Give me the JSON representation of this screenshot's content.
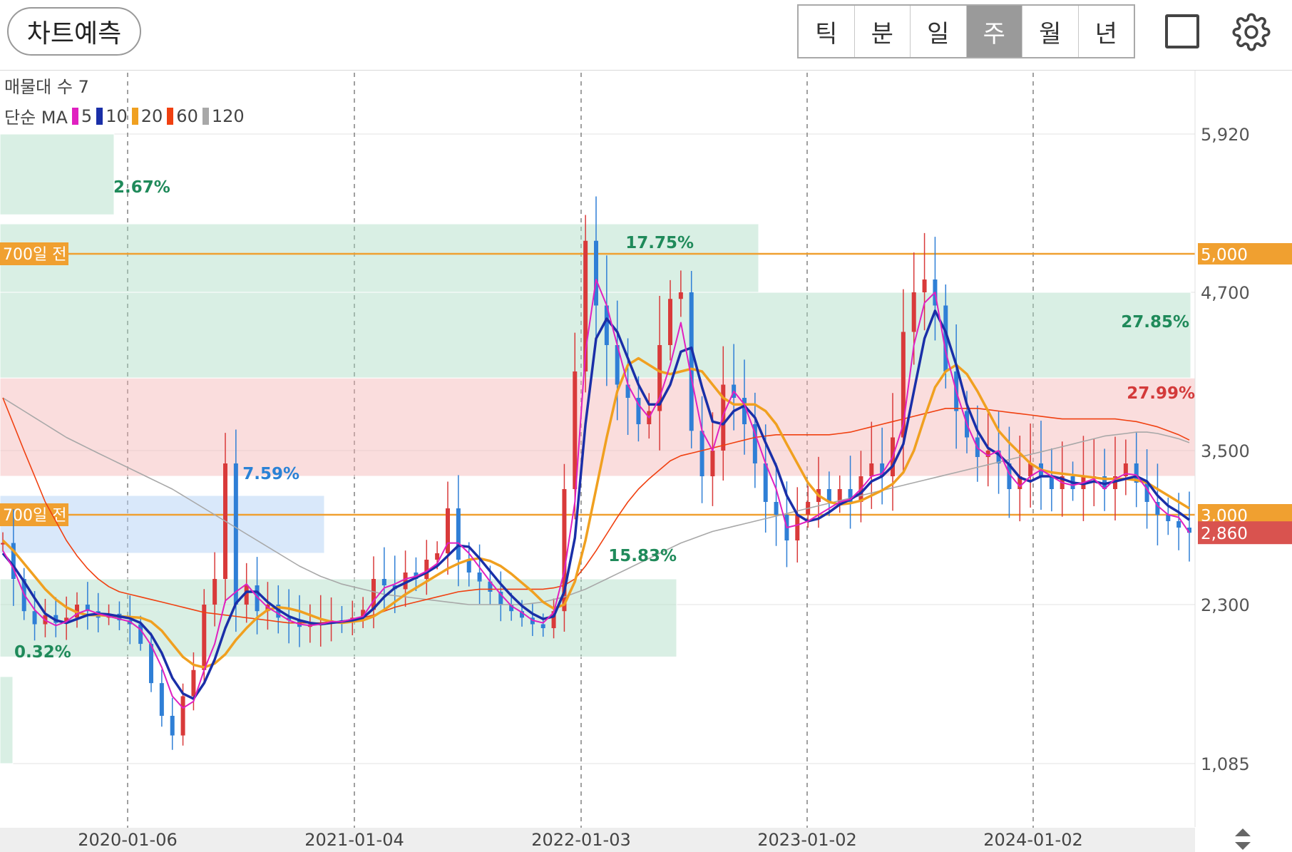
{
  "toolbar": {
    "predict_label": "차트예측",
    "period_tabs": [
      "틱",
      "분",
      "일",
      "주",
      "월",
      "년"
    ],
    "active_tab": "주",
    "icons": [
      "square-icon",
      "gear-icon"
    ]
  },
  "legend": {
    "volume_profile_label": "매물대 수 7",
    "ma_label": "단순 MA",
    "ma_items": [
      {
        "period": "5",
        "color": "#e020c0"
      },
      {
        "period": "10",
        "color": "#1a2fa8"
      },
      {
        "period": "20",
        "color": "#f0a020"
      },
      {
        "period": "60",
        "color": "#f04010"
      },
      {
        "period": "120",
        "color": "#a8a8a8"
      }
    ]
  },
  "chart_data": {
    "type": "candlestick",
    "interval": "weekly",
    "y_axis_ticks": [
      1085,
      2300,
      3500,
      4700,
      5920
    ],
    "y_axis_tick_labels": [
      "1,085",
      "2,300",
      "3,500",
      "4,700",
      "5,920"
    ],
    "x_axis_dates": [
      "2020-01-06",
      "2021-01-04",
      "2022-01-03",
      "2023-01-02",
      "2024-01-02"
    ],
    "current_price": {
      "value": 2860,
      "label": "2,860",
      "color": "#d9534f"
    },
    "reference_lines": [
      {
        "name": "700일 전",
        "value": 5000,
        "price_label": "5,000",
        "color": "#f0a030"
      },
      {
        "name": "700일 전",
        "value": 3000,
        "price_label": "3,000",
        "color": "#f0a030"
      }
    ],
    "volume_zones": [
      {
        "low": 5300,
        "high": 5920,
        "percent": "2.67%",
        "color": "green"
      },
      {
        "low": 4700,
        "high": 5230,
        "percent": "17.75%",
        "color": "green"
      },
      {
        "low": 4050,
        "high": 4700,
        "percent": "27.85%",
        "color": "green"
      },
      {
        "low": 3300,
        "high": 4050,
        "percent": "27.99%",
        "color": "red"
      },
      {
        "low": 2700,
        "high": 3150,
        "percent": "7.59%",
        "color": "blue"
      },
      {
        "low": 1900,
        "high": 2500,
        "percent": "15.83%",
        "color": "green"
      },
      {
        "low": 1085,
        "high": 1750,
        "percent": "0.32%",
        "color": "green"
      }
    ],
    "moving_averages": [
      {
        "period": 5,
        "values": [
          2720,
          2580,
          2380,
          2260,
          2180,
          2140,
          2170,
          2230,
          2260,
          2230,
          2210,
          2190,
          2170,
          2110,
          1990,
          1820,
          1600,
          1510,
          1560,
          1800,
          2000,
          2330,
          2400,
          2460,
          2360,
          2280,
          2230,
          2180,
          2150,
          2140,
          2150,
          2170,
          2170,
          2190,
          2210,
          2330,
          2430,
          2460,
          2500,
          2520,
          2560,
          2620,
          2780,
          2780,
          2700,
          2590,
          2480,
          2380,
          2290,
          2240,
          2180,
          2160,
          2240,
          2560,
          3100,
          4250,
          4800,
          4600,
          4300,
          4000,
          3850,
          3750,
          3900,
          4150,
          4470,
          4050,
          3650,
          3500,
          3770,
          3950,
          3850,
          3630,
          3400,
          3200,
          2900,
          2920,
          2950,
          3000,
          3050,
          3100,
          3120,
          3200,
          3300,
          3320,
          3450,
          3700,
          4300,
          4620,
          4700,
          4250,
          3950,
          3700,
          3520,
          3460,
          3500,
          3320,
          3220,
          3300,
          3350,
          3300,
          3250,
          3230,
          3250,
          3280,
          3200,
          3280,
          3320,
          3310,
          3200,
          3070,
          3000,
          2980,
          2860
        ]
      },
      {
        "period": 10,
        "values": [
          2700,
          2600,
          2480,
          2350,
          2230,
          2180,
          2160,
          2190,
          2220,
          2230,
          2225,
          2210,
          2195,
          2160,
          2070,
          1930,
          1740,
          1620,
          1580,
          1700,
          1880,
          2120,
          2310,
          2400,
          2400,
          2320,
          2260,
          2210,
          2180,
          2160,
          2150,
          2160,
          2170,
          2180,
          2200,
          2270,
          2360,
          2430,
          2470,
          2510,
          2550,
          2600,
          2680,
          2760,
          2750,
          2660,
          2560,
          2460,
          2370,
          2290,
          2230,
          2190,
          2210,
          2400,
          2820,
          3700,
          4350,
          4500,
          4400,
          4200,
          4000,
          3850,
          3850,
          4000,
          4250,
          4280,
          3980,
          3720,
          3700,
          3800,
          3840,
          3750,
          3560,
          3380,
          3150,
          3000,
          2950,
          2970,
          3020,
          3080,
          3120,
          3170,
          3260,
          3300,
          3380,
          3550,
          3950,
          4350,
          4560,
          4400,
          4150,
          3850,
          3650,
          3520,
          3470,
          3390,
          3290,
          3260,
          3300,
          3300,
          3280,
          3250,
          3240,
          3260,
          3240,
          3260,
          3280,
          3300,
          3260,
          3150,
          3070,
          3020,
          2960
        ]
      },
      {
        "period": 20,
        "values": [
          2800,
          2720,
          2620,
          2520,
          2420,
          2340,
          2280,
          2240,
          2220,
          2220,
          2215,
          2210,
          2205,
          2200,
          2170,
          2100,
          2000,
          1900,
          1840,
          1820,
          1850,
          1920,
          2030,
          2120,
          2200,
          2260,
          2280,
          2270,
          2250,
          2220,
          2190,
          2170,
          2160,
          2170,
          2180,
          2210,
          2260,
          2320,
          2380,
          2430,
          2480,
          2530,
          2580,
          2620,
          2650,
          2660,
          2640,
          2600,
          2540,
          2470,
          2400,
          2320,
          2270,
          2300,
          2480,
          2800,
          3200,
          3600,
          3950,
          4150,
          4200,
          4150,
          4100,
          4080,
          4100,
          4120,
          4100,
          4000,
          3900,
          3850,
          3850,
          3850,
          3800,
          3700,
          3550,
          3400,
          3250,
          3150,
          3100,
          3080,
          3090,
          3110,
          3150,
          3190,
          3240,
          3330,
          3500,
          3750,
          3980,
          4100,
          4150,
          4080,
          3950,
          3800,
          3650,
          3560,
          3480,
          3400,
          3350,
          3330,
          3320,
          3310,
          3300,
          3290,
          3280,
          3280,
          3280,
          3270,
          3250,
          3200,
          3150,
          3100,
          3050
        ]
      },
      {
        "period": 60,
        "values": [
          3900,
          3700,
          3500,
          3300,
          3100,
          2950,
          2800,
          2680,
          2580,
          2500,
          2440,
          2400,
          2380,
          2360,
          2340,
          2320,
          2300,
          2280,
          2260,
          2240,
          2230,
          2220,
          2210,
          2200,
          2190,
          2180,
          2170,
          2160,
          2160,
          2160,
          2160,
          2170,
          2170,
          2180,
          2200,
          2220,
          2250,
          2280,
          2300,
          2320,
          2340,
          2360,
          2380,
          2400,
          2410,
          2420,
          2420,
          2420,
          2420,
          2420,
          2420,
          2420,
          2430,
          2450,
          2500,
          2600,
          2720,
          2850,
          2980,
          3100,
          3200,
          3280,
          3350,
          3420,
          3460,
          3480,
          3500,
          3520,
          3540,
          3560,
          3580,
          3600,
          3610,
          3620,
          3620,
          3620,
          3620,
          3620,
          3620,
          3630,
          3640,
          3660,
          3680,
          3700,
          3720,
          3740,
          3760,
          3780,
          3800,
          3820,
          3820,
          3820,
          3820,
          3810,
          3800,
          3790,
          3780,
          3770,
          3760,
          3750,
          3740,
          3740,
          3740,
          3740,
          3740,
          3740,
          3730,
          3720,
          3700,
          3680,
          3650,
          3620,
          3580
        ]
      },
      {
        "period": 120,
        "values": [
          3900,
          3850,
          3800,
          3750,
          3700,
          3650,
          3600,
          3560,
          3520,
          3480,
          3440,
          3400,
          3360,
          3320,
          3280,
          3240,
          3200,
          3150,
          3100,
          3050,
          3000,
          2950,
          2900,
          2850,
          2800,
          2750,
          2700,
          2650,
          2600,
          2560,
          2520,
          2490,
          2460,
          2440,
          2420,
          2400,
          2380,
          2370,
          2360,
          2350,
          2340,
          2330,
          2320,
          2310,
          2300,
          2300,
          2300,
          2300,
          2300,
          2300,
          2310,
          2320,
          2340,
          2360,
          2390,
          2420,
          2460,
          2500,
          2540,
          2580,
          2620,
          2660,
          2700,
          2740,
          2780,
          2810,
          2840,
          2870,
          2890,
          2910,
          2930,
          2950,
          2970,
          2990,
          3010,
          3030,
          3050,
          3070,
          3090,
          3110,
          3130,
          3150,
          3170,
          3190,
          3210,
          3230,
          3250,
          3270,
          3290,
          3310,
          3330,
          3350,
          3370,
          3390,
          3410,
          3430,
          3450,
          3470,
          3490,
          3510,
          3530,
          3550,
          3570,
          3590,
          3610,
          3620,
          3630,
          3640,
          3640,
          3630,
          3610,
          3590,
          3560
        ]
      }
    ],
    "price_series": [
      2780,
      2500,
      2250,
      2150,
      2220,
      2160,
      2200,
      2300,
      2250,
      2200,
      2230,
      2180,
      2150,
      2000,
      1700,
      1450,
      1300,
      1600,
      1800,
      2300,
      2500,
      3400,
      2300,
      2450,
      2250,
      2300,
      2200,
      2180,
      2130,
      2150,
      2160,
      2180,
      2170,
      2200,
      2260,
      2500,
      2450,
      2420,
      2550,
      2500,
      2650,
      2700,
      3050,
      2650,
      2550,
      2480,
      2400,
      2300,
      2250,
      2200,
      2150,
      2120,
      2250,
      3200,
      4100,
      5100,
      4600,
      4300,
      4000,
      3900,
      3700,
      3800,
      4300,
      4650,
      4700,
      3650,
      3300,
      3500,
      4000,
      3900,
      3700,
      3400,
      3100,
      3000,
      2800,
      3000,
      3100,
      3200,
      3100,
      3200,
      3100,
      3300,
      3400,
      3300,
      3600,
      4400,
      4700,
      4800,
      4600,
      4100,
      3800,
      3600,
      3450,
      3500,
      3400,
      3200,
      3300,
      3400,
      3300,
      3200,
      3300,
      3200,
      3300,
      3300,
      3200,
      3300,
      3400,
      3250,
      3100,
      3000,
      2950,
      2900,
      2860
    ]
  }
}
